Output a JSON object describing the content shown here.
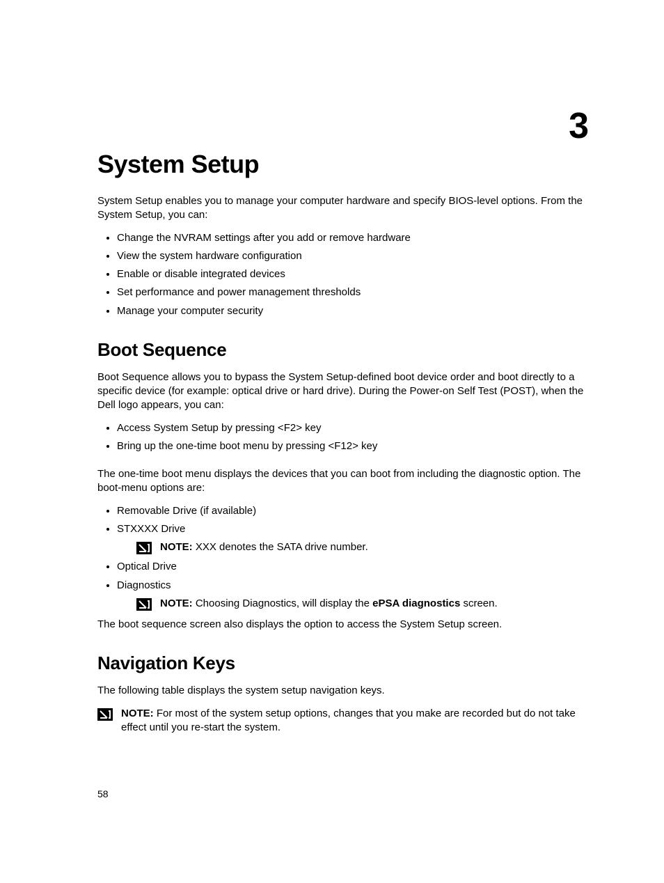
{
  "chapter_number": "3",
  "page_number": "58",
  "title": "System Setup",
  "intro": "System Setup enables you to manage your computer hardware and specify BIOS-level options. From the System Setup, you can:",
  "intro_bullets": [
    "Change the NVRAM settings after you add or remove hardware",
    "View the system hardware configuration",
    "Enable or disable integrated devices",
    "Set performance and power management thresholds",
    "Manage your computer security"
  ],
  "boot": {
    "heading": "Boot Sequence",
    "para1": "Boot Sequence allows you to bypass the System Setup-defined boot device order and boot directly to a specific device (for example: optical drive or hard drive). During the Power-on Self Test (POST), when the Dell logo appears, you can:",
    "bullets1": [
      "Access System Setup by pressing <F2> key",
      "Bring up the one-time boot menu by pressing <F12> key"
    ],
    "para2": "The one-time boot menu displays the devices that you can boot from including the diagnostic option. The boot-menu options are:",
    "bullets2": {
      "item1": "Removable Drive (if available)",
      "item2": "STXXXX Drive",
      "item2_note_label": "NOTE: ",
      "item2_note_text": "XXX denotes the SATA drive number.",
      "item3": "Optical Drive",
      "item4": "Diagnostics",
      "item4_note_label": "NOTE: ",
      "item4_note_pre": "Choosing Diagnostics, will display the ",
      "item4_note_bold": "ePSA diagnostics",
      "item4_note_post": " screen."
    },
    "para3": "The boot sequence screen also displays the option to access the System Setup screen."
  },
  "nav": {
    "heading": "Navigation Keys",
    "para1": "The following table displays the system setup navigation keys.",
    "note_label": "NOTE: ",
    "note_text": "For most of the system setup options, changes that you make are recorded but do not take effect until you re-start the system."
  }
}
